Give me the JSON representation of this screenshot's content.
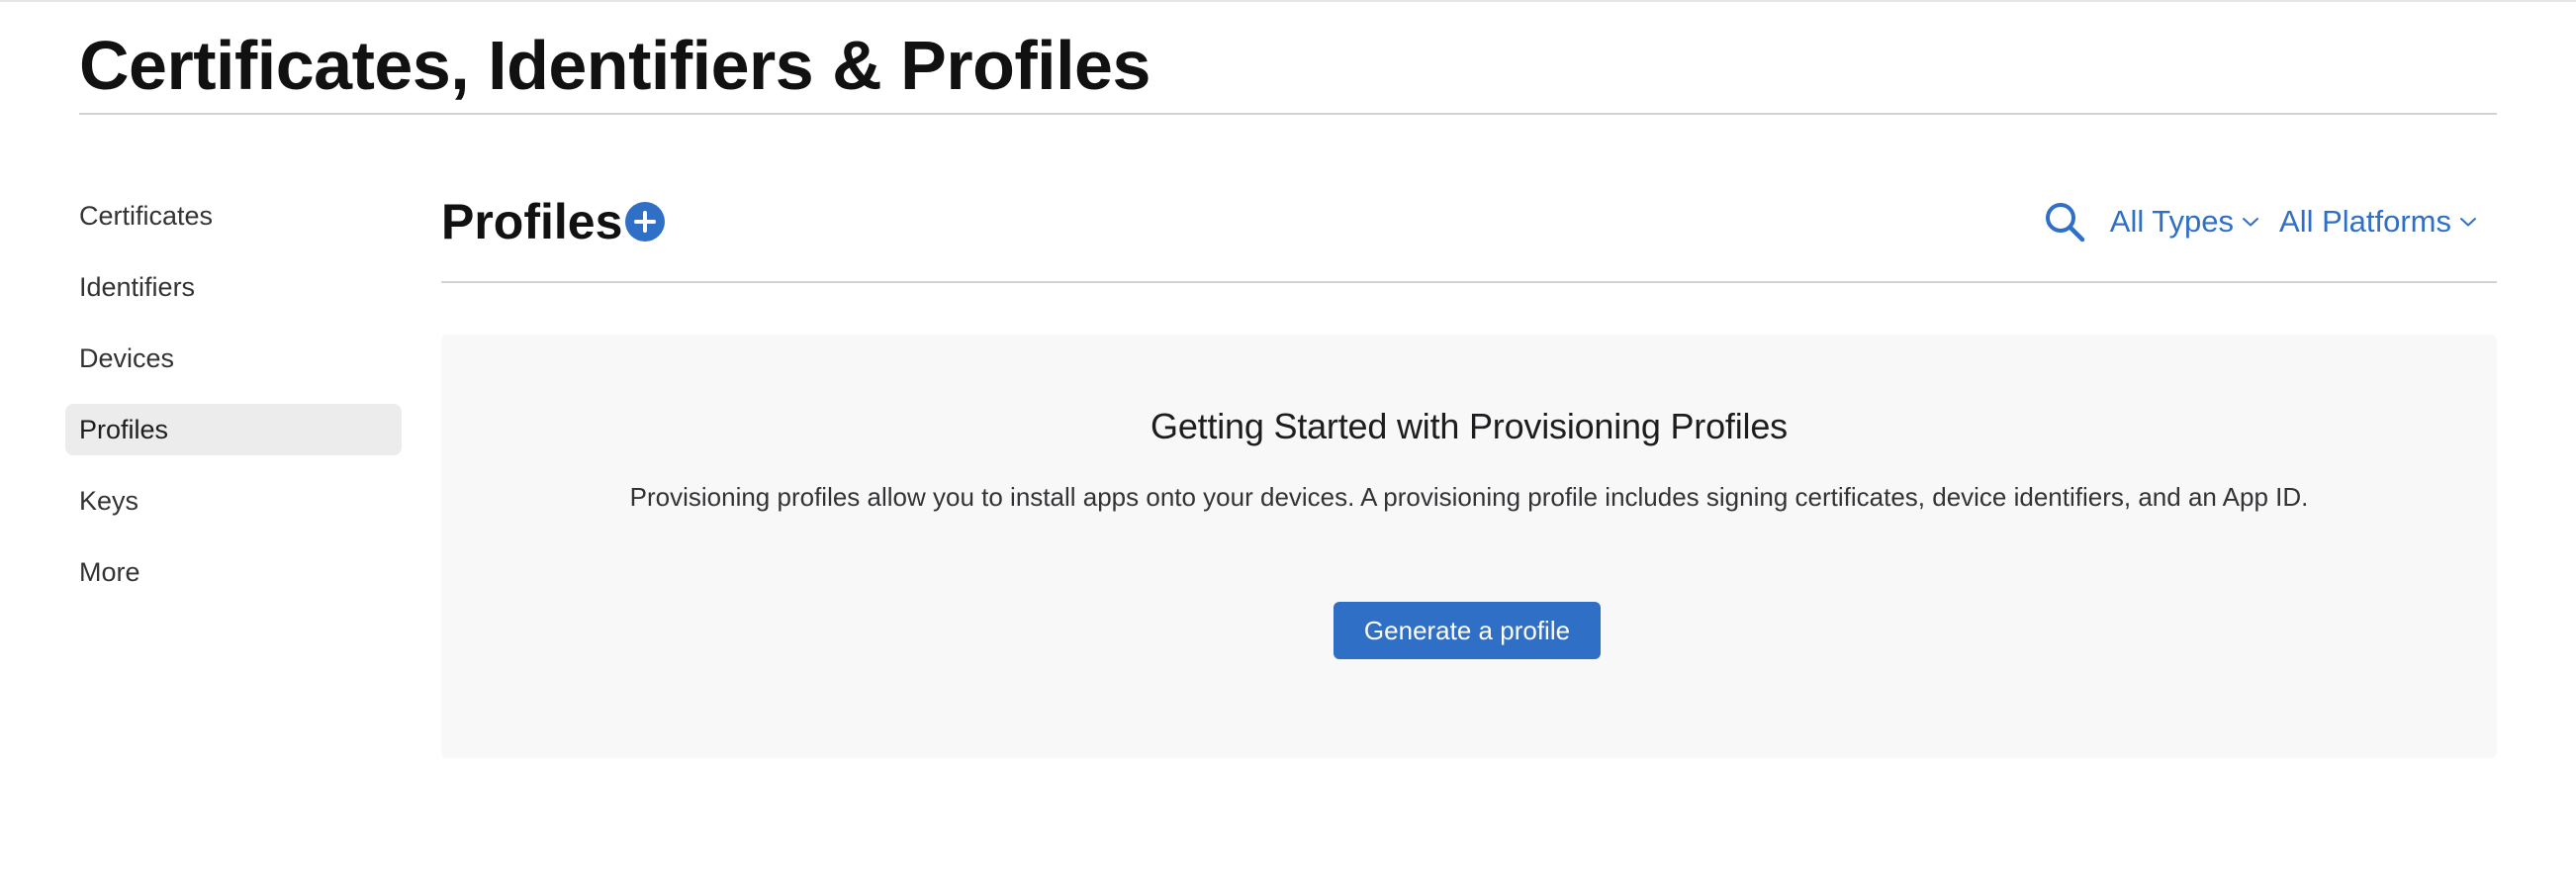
{
  "page": {
    "title": "Certificates, Identifiers & Profiles"
  },
  "sidebar": {
    "items": [
      {
        "label": "Certificates",
        "active": false
      },
      {
        "label": "Identifiers",
        "active": false
      },
      {
        "label": "Devices",
        "active": false
      },
      {
        "label": "Profiles",
        "active": true
      },
      {
        "label": "Keys",
        "active": false
      },
      {
        "label": "More",
        "active": false
      }
    ]
  },
  "section": {
    "title": "Profiles",
    "add_icon": "plus-circle-icon",
    "search_icon": "search-icon",
    "filters": {
      "types": "All Types",
      "platforms": "All Platforms",
      "chevron_icon": "chevron-down-icon"
    }
  },
  "empty_state": {
    "title": "Getting Started with Provisioning Profiles",
    "description": "Provisioning profiles allow you to install apps onto your devices. A provisioning profile includes signing certificates, device identifiers, and an App ID.",
    "button_label": "Generate a profile"
  },
  "colors": {
    "accent": "#2f6fc5",
    "active_nav_bg": "#ececec",
    "card_bg": "#f8f8f8",
    "divider": "#d2d2d7"
  }
}
